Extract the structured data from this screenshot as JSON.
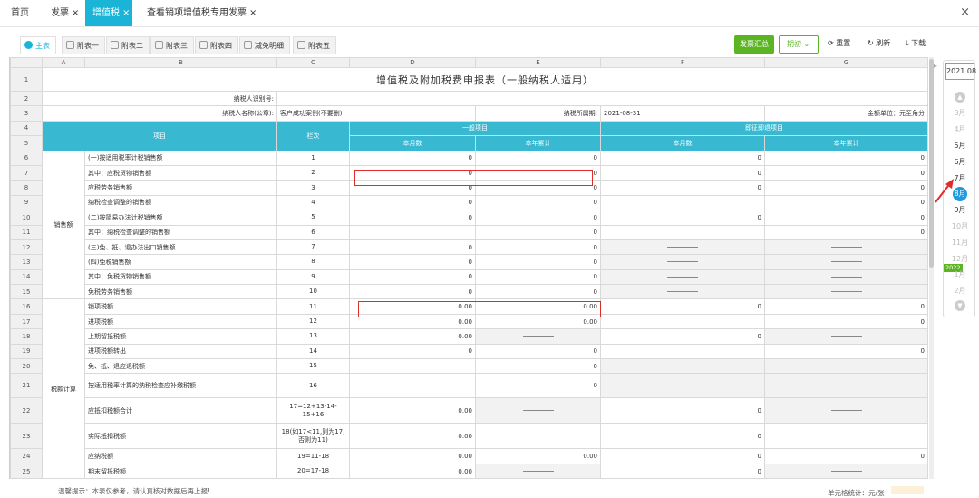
{
  "top_tabs": [
    {
      "label": "首页",
      "closable": false,
      "active": false
    },
    {
      "label": "发票",
      "closable": true,
      "active": false
    },
    {
      "label": "增值税",
      "closable": true,
      "active": true
    },
    {
      "label": "查看销项增值税专用发票",
      "closable": true,
      "active": false
    }
  ],
  "close_glyph": "×",
  "sheet_tabs": [
    "主表",
    "附表一",
    "附表二",
    "附表三",
    "附表四",
    "减免明细",
    "附表五"
  ],
  "toolbar": {
    "summary": "发票汇总",
    "period": "期初",
    "reset": "重置",
    "refresh": "刷新",
    "download": "下载"
  },
  "columns": [
    "A",
    "B",
    "C",
    "D",
    "E",
    "F",
    "G"
  ],
  "sheet": {
    "title": "增值税及附加税费申报表（一般纳税人适用）",
    "taxpayer_id_label": "纳税人识别号:",
    "taxpayer_name_label": "纳税人名称(公章):",
    "taxpayer_name": "客户成功案例(不要删)",
    "period_label": "纳税所属期:",
    "period": "2021-08-31",
    "unit": "金额单位：元至角分",
    "hdr_item": "项目",
    "hdr_col": "栏次",
    "hdr_general": "一般项目",
    "hdr_refund": "即征即退项目",
    "hdr_month": "本月数",
    "hdr_year": "本年累计",
    "group_sales": "销售额",
    "group_tax": "税款计算"
  },
  "rows": [
    {
      "n": "6",
      "item": "(一)按适用税率计税销售额",
      "col": "1",
      "d": "0",
      "e": "0",
      "f": "0",
      "g": "0"
    },
    {
      "n": "7",
      "item": "其中：应税货物销售额",
      "col": "2",
      "d": "0",
      "e": "0",
      "f": "0",
      "g": "0"
    },
    {
      "n": "8",
      "item": "应税劳务销售额",
      "col": "3",
      "d": "0",
      "e": "0",
      "f": "0",
      "g": "0"
    },
    {
      "n": "9",
      "item": "纳税检查调整的销售额",
      "col": "4",
      "d": "0",
      "e": "0",
      "f": "",
      "g": "0"
    },
    {
      "n": "10",
      "item": "(二)按简易办法计税销售额",
      "col": "5",
      "d": "0",
      "e": "0",
      "f": "0",
      "g": "0"
    },
    {
      "n": "11",
      "item": "其中：纳税检查调整的销售额",
      "col": "6",
      "d": "",
      "e": "0",
      "f": "",
      "g": "0"
    },
    {
      "n": "12",
      "item": "(三)免、抵、退办法出口销售额",
      "col": "7",
      "d": "0",
      "e": "0",
      "f": "—",
      "g": "—"
    },
    {
      "n": "13",
      "item": "(四)免税销售额",
      "col": "8",
      "d": "0",
      "e": "0",
      "f": "—",
      "g": "—"
    },
    {
      "n": "14",
      "item": "其中：免税货物销售额",
      "col": "9",
      "d": "0",
      "e": "0",
      "f": "—",
      "g": "—"
    },
    {
      "n": "15",
      "item": "免税劳务销售额",
      "col": "10",
      "d": "0",
      "e": "0",
      "f": "—",
      "g": "—"
    },
    {
      "n": "16",
      "item": "销项税额",
      "col": "11",
      "d": "0.00",
      "e": "0.00",
      "f": "0",
      "g": "0"
    },
    {
      "n": "17",
      "item": "进项税额",
      "col": "12",
      "d": "0.00",
      "e": "0.00",
      "f": "",
      "g": "0"
    },
    {
      "n": "18",
      "item": "上期留抵税额",
      "col": "13",
      "d": "0.00",
      "e": "—",
      "f": "0",
      "g": "—"
    },
    {
      "n": "19",
      "item": "进项税额转出",
      "col": "14",
      "d": "0",
      "e": "0",
      "f": "",
      "g": "0"
    },
    {
      "n": "20",
      "item": "免、抵、退应退税额",
      "col": "15",
      "d": "",
      "e": "0",
      "f": "—",
      "g": "—"
    },
    {
      "n": "21",
      "item": "按适用税率计算的纳税检查应补缴税额",
      "col": "16",
      "d": "",
      "e": "0",
      "f": "—",
      "g": "—"
    },
    {
      "n": "22",
      "item": "应抵扣税额合计",
      "col": "17=12+13-14-15+16",
      "d": "0.00",
      "e": "—",
      "f": "0",
      "g": "—"
    },
    {
      "n": "23",
      "item": "实际抵扣税额",
      "col": "18(如17<11,则为17,否则为11)",
      "d": "0.00",
      "e": "",
      "f": "0",
      "g": ""
    },
    {
      "n": "24",
      "item": "应纳税额",
      "col": "19=11-18",
      "d": "0.00",
      "e": "0.00",
      "f": "0",
      "g": "0"
    },
    {
      "n": "25",
      "item": "期末留抵税额",
      "col": "20=17-18",
      "d": "0.00",
      "e": "—",
      "f": "0",
      "g": "—"
    }
  ],
  "calendar": {
    "year": "2021.08",
    "months": [
      "3月",
      "4月",
      "5月",
      "6月",
      "7月",
      "8月",
      "9月",
      "10月",
      "11月",
      "12月",
      "1月",
      "2月"
    ],
    "selected": "8月",
    "next_year": "2022"
  },
  "footer": {
    "tip": "温馨提示：本表仅参考，请认真核对数据后再上报!",
    "right": "单元格统计：元/张"
  },
  "colors": {
    "accent": "#1ab5d6",
    "header": "#38b9d1",
    "green": "#5bb523",
    "highlight": "#e02b2b",
    "calendar_selected": "#1e9be0"
  }
}
